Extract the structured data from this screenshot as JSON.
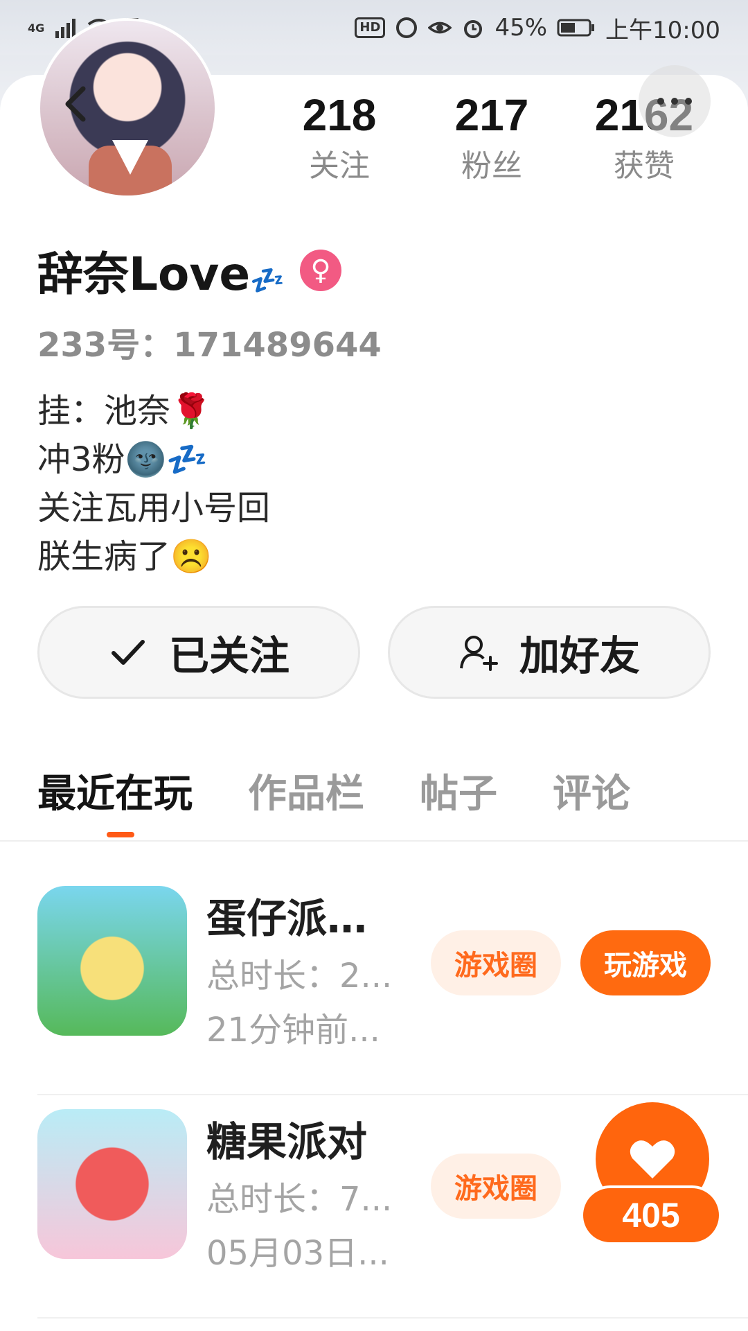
{
  "status_bar": {
    "network": "4G",
    "battery": "45%",
    "time": "上午10:00",
    "hd_label": "HD"
  },
  "profile": {
    "name": "辞奈Love",
    "name_suffix": "💤",
    "gender_symbol": "♀",
    "user_id": "233号：171489644",
    "bio": [
      "挂：池奈🌹",
      "冲3粉🌚💤",
      "关注瓦用小号回",
      "朕生病了☹️"
    ]
  },
  "stats": [
    {
      "value": "218",
      "label": "关注"
    },
    {
      "value": "217",
      "label": "粉丝"
    },
    {
      "value": "2162",
      "label": "获赞"
    }
  ],
  "actions": {
    "follow_label": "已关注",
    "add_friend_label": "加好友"
  },
  "tabs": [
    "最近在玩",
    "作品栏",
    "帖子",
    "评论"
  ],
  "games": [
    {
      "name": "蛋仔派...",
      "duration": "总时长：2...",
      "last_played": "21分钟前...",
      "circle_label": "游戏圈",
      "play_label": "玩游戏"
    },
    {
      "name": "糖果派对",
      "duration": "总时长：7...",
      "last_played": "05月03日...",
      "circle_label": "游戏圈"
    }
  ],
  "like_fab": {
    "count": "405"
  },
  "colors": {
    "accent": "#ff6a10",
    "accent_light": "#fff0e6",
    "gender_pink": "#f25a83"
  }
}
